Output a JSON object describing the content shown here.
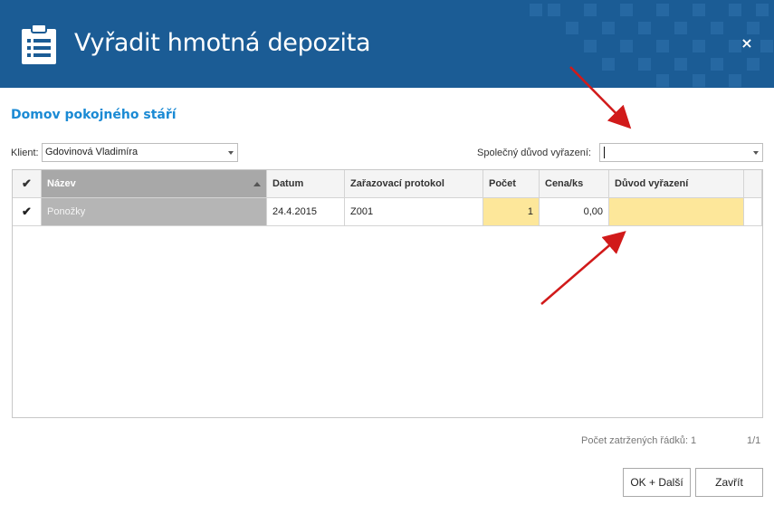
{
  "header": {
    "title": "Vyřadit hmotná depozita",
    "close_label": "×",
    "icon": "clipboard-list-icon",
    "bg_color": "#1b5c95"
  },
  "subtitle": "Domov pokojného stáří",
  "client": {
    "label": "Klient:",
    "value": "Gdovinová Vladimíra"
  },
  "common_reason": {
    "label": "Společný důvod vyřazení:",
    "value": ""
  },
  "grid": {
    "columns": [
      "Název",
      "Datum",
      "Zařazovací protokol",
      "Počet",
      "Cena/ks",
      "Důvod vyřazení"
    ],
    "header_check_icon": "checkmark-icon",
    "rows": [
      {
        "check_icon": "checkmark-icon",
        "name": "Ponožky",
        "date": "24.4.2015",
        "protocol": "Z001",
        "count": "1",
        "price": "0,00",
        "reason": ""
      }
    ]
  },
  "footer": {
    "checked_rows": "Počet zatržených řádků: 1",
    "page": "1/1"
  },
  "buttons": {
    "ok_next": "OK + Další",
    "close": "Zavřít"
  },
  "colors": {
    "accent": "#1a8ad4",
    "highlight": "#fde79a",
    "check": "#4aa02c",
    "annotation_arrow": "#d11a1a"
  }
}
